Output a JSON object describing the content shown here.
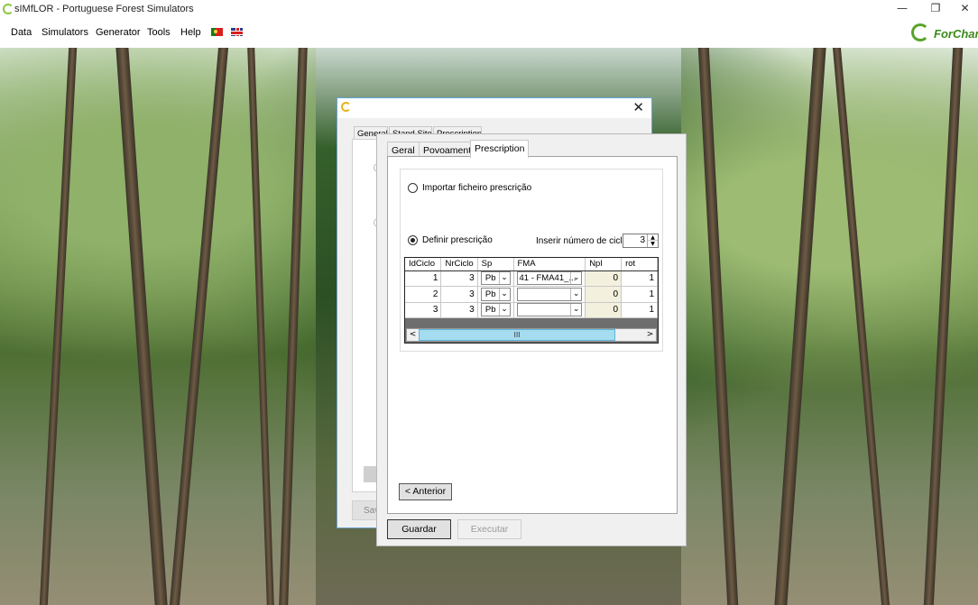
{
  "window": {
    "title": "sIMfLOR - Portuguese Forest Simulators",
    "minimize_glyph": "—",
    "maximize_glyph": "❐",
    "close_glyph": "✕"
  },
  "menu": {
    "items": [
      "Data",
      "Simulators",
      "Generator",
      "Tools",
      "Help"
    ]
  },
  "logo": {
    "text": "ForChang"
  },
  "back_dialog": {
    "tabs": [
      "General",
      "Stand Site",
      "Prescription"
    ],
    "save_label": "Sav",
    "close_glyph": "✕"
  },
  "front_dialog": {
    "tabs": [
      "Geral",
      "Povoamento",
      "Prescription"
    ],
    "active_tab": "Prescription",
    "option_import": "Importar ficheiro prescrição",
    "option_define": "Definir prescrição",
    "cycles_label": "Inserir número de ciclos",
    "cycles_value": "3",
    "grid": {
      "columns": [
        "IdCiclo",
        "NrCiclo",
        "Sp",
        "FMA",
        "Npl",
        "rot"
      ],
      "rows": [
        {
          "id": "1",
          "nr": "3",
          "sp": "Pb",
          "fma": "41 - FMA41_...",
          "npl": "0",
          "rot": "1"
        },
        {
          "id": "2",
          "nr": "3",
          "sp": "Pb",
          "fma": "",
          "npl": "0",
          "rot": "1"
        },
        {
          "id": "3",
          "nr": "3",
          "sp": "Pb",
          "fma": "",
          "npl": "0",
          "rot": "1"
        }
      ],
      "scroll_thumb_glyph": "III",
      "scroll_left_glyph": "<",
      "scroll_right_glyph": ">"
    },
    "back_button": "< Anterior",
    "save_button": "Guardar",
    "run_button": "Executar"
  },
  "colors": {
    "accent_green": "#5aa329",
    "scroll_thumb": "#a6dcef",
    "dialog_border": "#6aa3d8"
  }
}
